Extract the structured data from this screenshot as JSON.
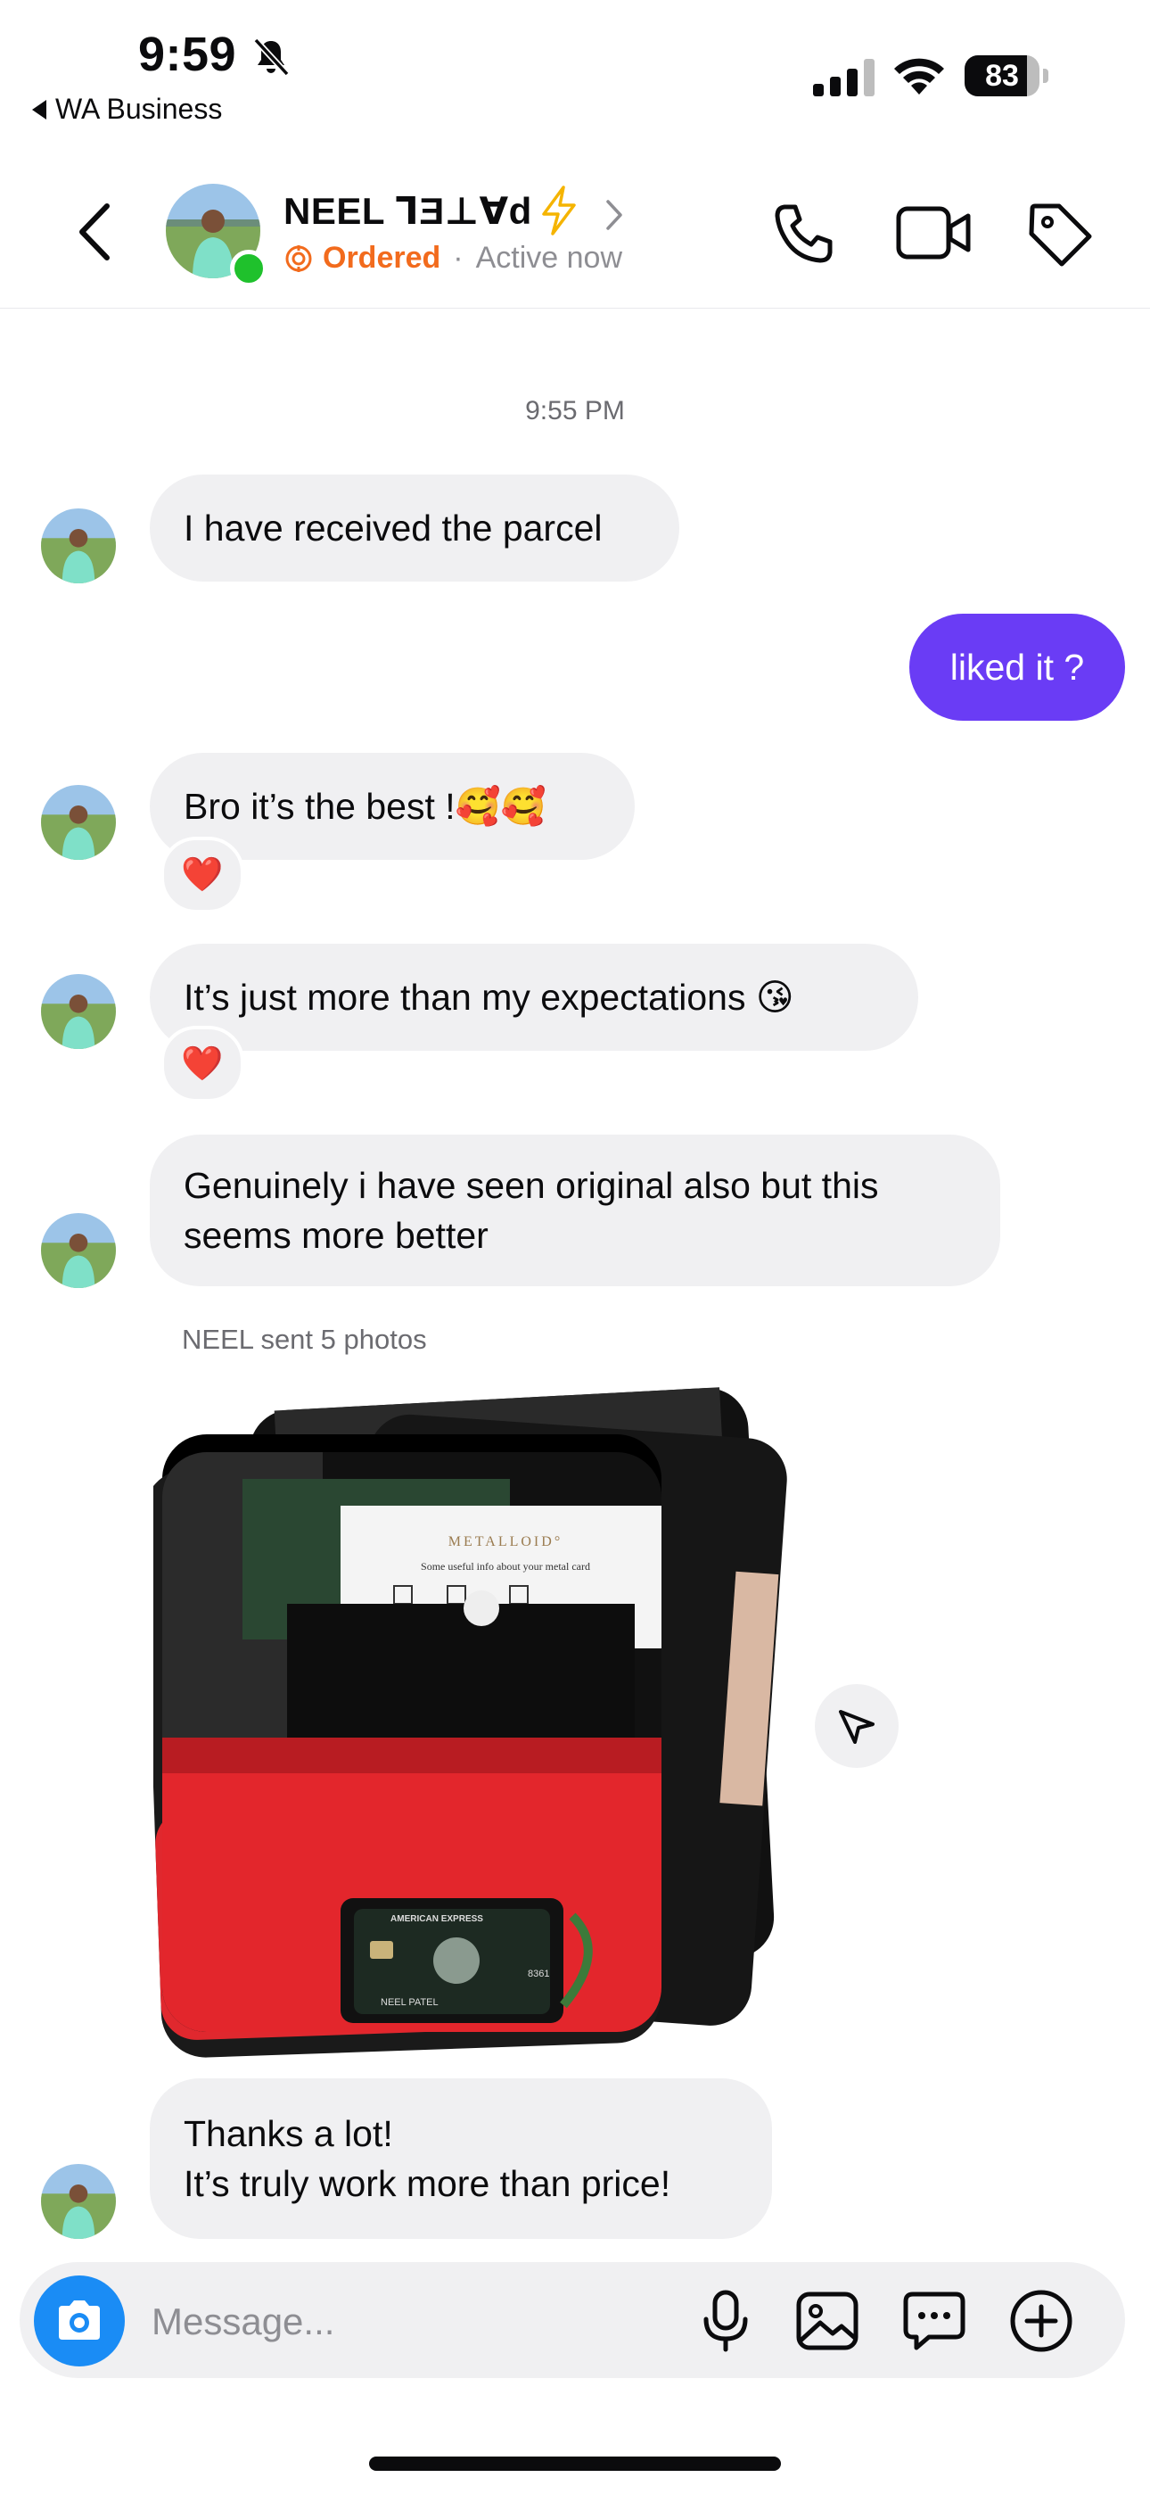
{
  "status_bar": {
    "time": "9:59",
    "back_app": "WA Business",
    "battery_level": "83",
    "battery_fraction": 0.83
  },
  "header": {
    "contact_name": "NEEL ᒣƎ⊥∀d",
    "label": "Ordered",
    "separator": "·",
    "presence": "Active now",
    "accent_color": "#f26b1d",
    "online_color": "#1fc12c"
  },
  "chat": {
    "timestamp": "9:55 PM",
    "messages": [
      {
        "text": "I have received the parcel"
      },
      {
        "text": "liked it ?"
      },
      {
        "text": "Bro it’s the best !🥰🥰",
        "reaction": "❤️"
      },
      {
        "text": "It’s just more than my expectations 😘",
        "reaction": "❤️"
      },
      {
        "lines": [
          "Genuinely i have seen original also but this",
          "seems more better"
        ]
      },
      {
        "lines": [
          "Thanks a lot!",
          "It’s truly work more than price!"
        ]
      }
    ],
    "photos_label": "NEEL sent 5 photos",
    "photo": {
      "card_brand": "AMERICAN EXPRESS",
      "card_name": "NEEL PATEL",
      "card_digits": "8361",
      "sheet_brand": "METALLOID°",
      "sheet_caption": "Some useful info about your metal card"
    },
    "outgoing_color": "#6a3cf5"
  },
  "composer": {
    "placeholder": "Message...",
    "camera_color": "#1a8cf5"
  }
}
